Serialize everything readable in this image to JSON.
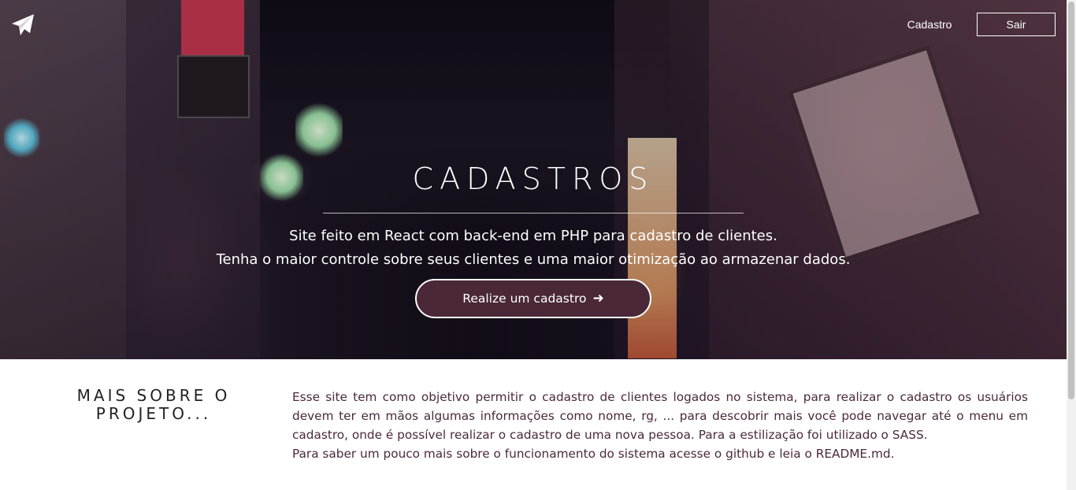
{
  "nav": {
    "logo_icon": "paper-plane-icon",
    "cadastro_link": "Cadastro",
    "sair_button": "Sair"
  },
  "hero": {
    "title": "CADASTROS",
    "subtitle_line1": "Site feito em React com back-end em PHP para cadastro de clientes.",
    "subtitle_line2": "Tenha o maior controle sobre seus clientes e uma maior otimização ao armazenar dados.",
    "cta_label": "Realize um cadastro",
    "cta_icon": "arrow-right-icon"
  },
  "about": {
    "title_line1": "MAIS SOBRE O",
    "title_line2": "PROJETO...",
    "paragraph1": "Esse site tem como objetivo permitir o cadastro de clientes logados no sistema, para realizar o cadastro os usuários devem ter em mãos algumas informações como nome, rg, ... para descobrir mais você pode navegar até o menu em cadastro, onde é possível realizar o cadastro de uma nova pessoa. Para a estilização foi utilizado o SASS.",
    "paragraph2": "Para saber um pouco mais sobre o funcionamento do sistema acesse o github e leia o README.md."
  },
  "colors": {
    "accent": "#4a2838",
    "text_dark": "#4a2a3a",
    "white": "#ffffff"
  }
}
